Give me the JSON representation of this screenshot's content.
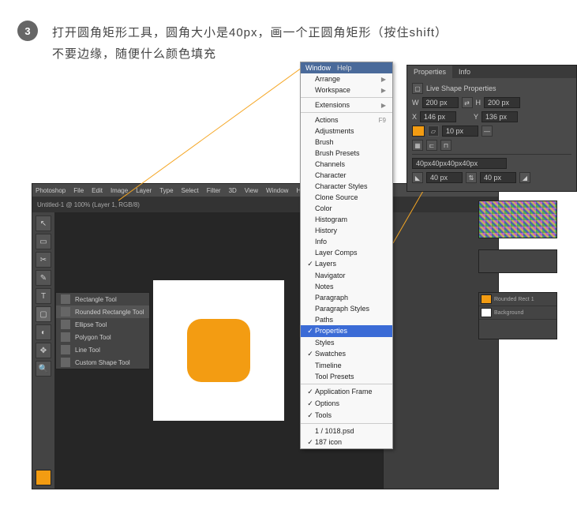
{
  "step": {
    "num": "3",
    "text": "打开圆角矩形工具，圆角大小是40px，画一个正圆角矩形（按住shift）\n不要边缘，随便什么颜色填充"
  },
  "menubar": [
    "Photoshop",
    "File",
    "Edit",
    "Image",
    "Layer",
    "Type",
    "Select",
    "Filter",
    "3D",
    "View",
    "Window",
    "Help"
  ],
  "tabname": "Untitled-1 @ 100% (Layer 1, RGB/8)",
  "toolFly": {
    "items": [
      "Rectangle Tool",
      "Rounded Rectangle Tool",
      "Ellipse Tool",
      "Polygon Tool",
      "Line Tool",
      "Custom Shape Tool"
    ]
  },
  "windowMenu": {
    "head": [
      "Window",
      "Help"
    ],
    "groups": [
      [
        {
          "l": "Arrange",
          "s": true
        },
        {
          "l": "Workspace",
          "s": true
        }
      ],
      [
        {
          "l": "Extensions",
          "s": true
        }
      ],
      [
        {
          "l": "Actions",
          "k": "F9"
        },
        {
          "l": "Adjustments"
        },
        {
          "l": "Brush"
        },
        {
          "l": "Brush Presets"
        },
        {
          "l": "Channels"
        },
        {
          "l": "Character"
        },
        {
          "l": "Character Styles"
        },
        {
          "l": "Clone Source"
        },
        {
          "l": "Color"
        },
        {
          "l": "Histogram"
        },
        {
          "l": "History"
        },
        {
          "l": "Info"
        },
        {
          "l": "Layer Comps"
        },
        {
          "l": "Layers",
          "c": true
        },
        {
          "l": "Navigator"
        },
        {
          "l": "Notes"
        },
        {
          "l": "Paragraph"
        },
        {
          "l": "Paragraph Styles"
        },
        {
          "l": "Paths"
        },
        {
          "l": "Properties",
          "hl": true,
          "c": true
        },
        {
          "l": "Styles"
        },
        {
          "l": "Swatches",
          "c": true
        },
        {
          "l": "Timeline"
        },
        {
          "l": "Tool Presets"
        }
      ],
      [
        {
          "l": "Application Frame",
          "c": true
        },
        {
          "l": "Options",
          "c": true
        },
        {
          "l": "Tools",
          "c": true
        }
      ],
      [
        {
          "l": "1 / 1018.psd"
        },
        {
          "l": "187 icon",
          "c": true
        }
      ]
    ]
  },
  "props": {
    "tabs": [
      "Properties",
      "Info"
    ],
    "title": "Live Shape Properties",
    "w": {
      "label": "W",
      "val": "200 px"
    },
    "h": {
      "label": "H",
      "val": "200 px"
    },
    "x": {
      "label": "X",
      "val": "146 px"
    },
    "y": {
      "label": "Y",
      "val": "136 px"
    },
    "stroke": "10 px",
    "radii": "40px40px40px40px",
    "r": [
      "40 px",
      "40 px"
    ],
    "fill": "#f39c12"
  },
  "layers": {
    "items": [
      {
        "name": "Rounded Rect 1",
        "c": "#f39c12"
      },
      {
        "name": "Background",
        "c": "#fff"
      }
    ]
  },
  "tools": [
    "↖",
    "▭",
    "✂",
    "✎",
    "T",
    "▢",
    "◐",
    "✥",
    "🔍"
  ]
}
